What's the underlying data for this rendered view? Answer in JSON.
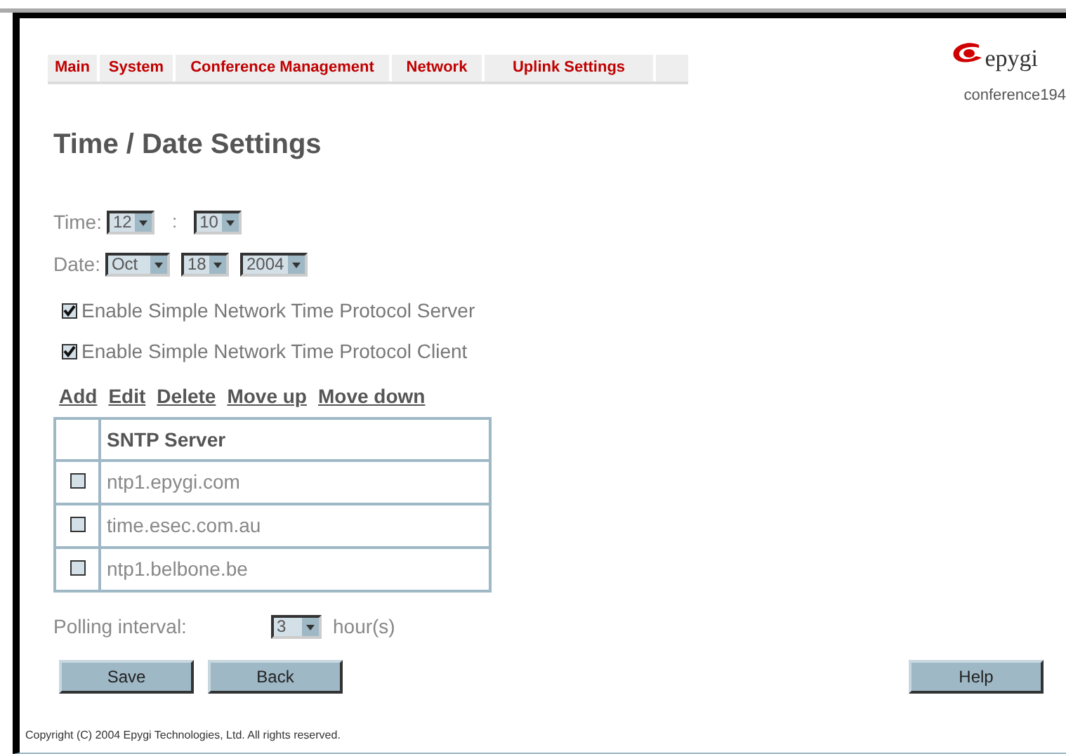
{
  "nav_tabs": [
    {
      "label": "Main"
    },
    {
      "label": "System"
    },
    {
      "label": "Conference Management"
    },
    {
      "label": "Network"
    },
    {
      "label": "Uplink Settings"
    }
  ],
  "logo": {
    "text": "epygi"
  },
  "device_name": "conference194",
  "title": "Time / Date Settings",
  "time": {
    "label": "Time:",
    "hour": "12",
    "separator": ":",
    "minute": "10"
  },
  "date": {
    "label": "Date:",
    "month": "Oct",
    "day": "18",
    "year": "2004"
  },
  "options": [
    {
      "label": "Enable Simple Network Time Protocol Server",
      "checked": true
    },
    {
      "label": "Enable Simple Network Time Protocol Client",
      "checked": true
    }
  ],
  "actions": [
    "Add",
    "Edit",
    "Delete",
    "Move up",
    "Move down"
  ],
  "table": {
    "columns": [
      "SNTP Server"
    ],
    "rows": [
      {
        "server": "ntp1.epygi.com",
        "selected": false
      },
      {
        "server": "time.esec.com.au",
        "selected": false
      },
      {
        "server": "ntp1.belbone.be",
        "selected": false
      }
    ]
  },
  "polling": {
    "label": "Polling interval:",
    "value": "3",
    "unit": "hour(s)"
  },
  "buttons": [
    "Save",
    "Back"
  ],
  "help_button": "Help",
  "footer": "Copyright (C) 2004 Epygi Technologies, Ltd. All rights reserved."
}
